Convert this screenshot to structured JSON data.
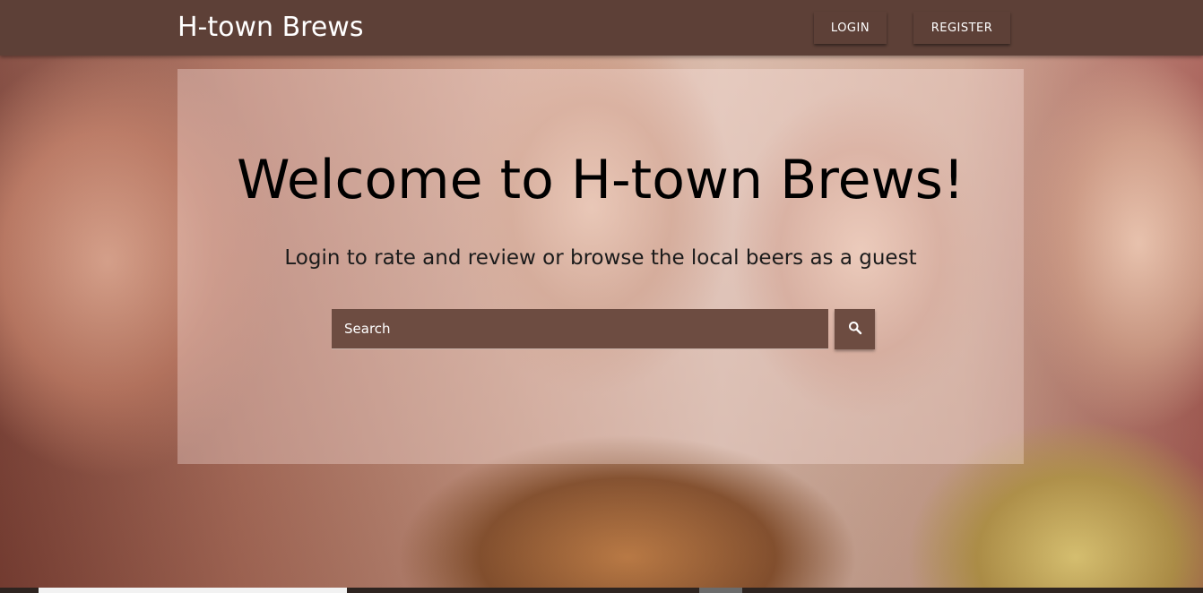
{
  "navbar": {
    "brand": "H-town Brews",
    "login_label": "LOGIN",
    "register_label": "REGISTER",
    "background_color": "#5d4037"
  },
  "hero": {
    "image": "photo of friends laughing and toasting with drinks",
    "welcome_title": "Welcome to H-town Brews!",
    "subtitle": "Login to rate and review or browse the local beers as a guest"
  },
  "search": {
    "placeholder": "Search",
    "button_icon": "search-icon",
    "background_color": "#6d4c41"
  }
}
